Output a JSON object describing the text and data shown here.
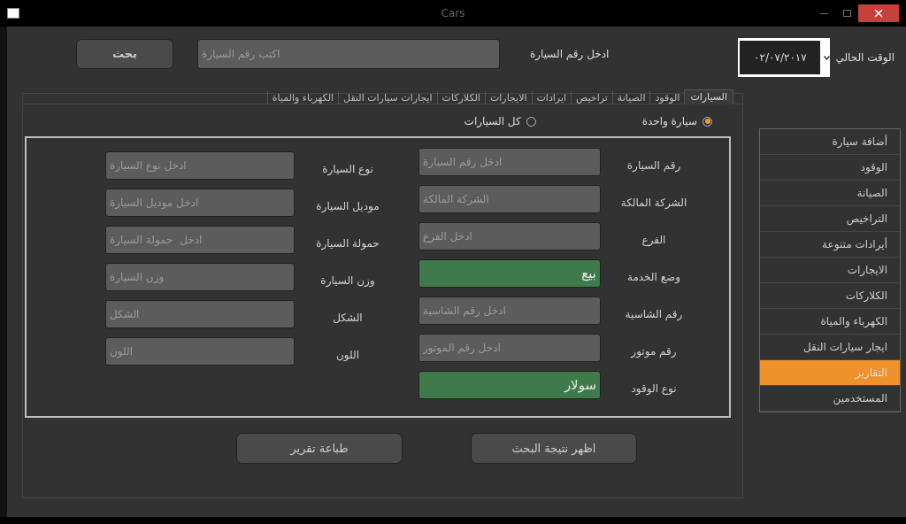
{
  "window": {
    "title": "Cars"
  },
  "search": {
    "label": "ادخل رقم السيارة",
    "placeholder": "اكتب رقم السيارة",
    "button": "بحث"
  },
  "current_time": {
    "label": "الوقت الحالي",
    "value": "٠٢/٠٧/٢٠١٧"
  },
  "tabs": [
    {
      "label": "السيارات",
      "selected": true
    },
    {
      "label": "الوقود",
      "selected": false
    },
    {
      "label": "الصيانة",
      "selected": false
    },
    {
      "label": "تراخيص",
      "selected": false
    },
    {
      "label": "ايرادات",
      "selected": false
    },
    {
      "label": "الايجارات",
      "selected": false
    },
    {
      "label": "الكلاركات",
      "selected": false
    },
    {
      "label": "ايجارات سيارات النقل",
      "selected": false
    },
    {
      "label": "الكهرباء والمياة",
      "selected": false
    }
  ],
  "scope": [
    {
      "label": "سيارة واحدة",
      "selected": true
    },
    {
      "label": "كل السيارات",
      "selected": false
    }
  ],
  "form_right": [
    {
      "label": "رقم السيارة",
      "kind": "text",
      "placeholder": "ادخل رقم السيارة"
    },
    {
      "label": "الشركة المالكة",
      "kind": "text",
      "placeholder": "الشركة المالكة"
    },
    {
      "label": "الفرع",
      "kind": "text",
      "placeholder": "ادخل الفرع"
    },
    {
      "label": "وضع الخدمة",
      "kind": "combo",
      "value": "بيع"
    },
    {
      "label": "رقم الشاسية",
      "kind": "text",
      "placeholder": "ادخل رقم الشاسية"
    },
    {
      "label": "رقم موتور",
      "kind": "text",
      "placeholder": "ادخل رقم الموتور"
    },
    {
      "label": "نوع الوقود",
      "kind": "combo",
      "value": "سولار"
    }
  ],
  "form_left": [
    {
      "label": "نوع السيارة",
      "kind": "text",
      "placeholder": "ادخل نوع السيارة"
    },
    {
      "label": "موديل السيارة",
      "kind": "text",
      "placeholder": "ادخل موديل السيارة"
    },
    {
      "label": "حمولة السيارة",
      "kind": "text",
      "placeholder": "ادخل  حمولة السيارة"
    },
    {
      "label": "وزن السيارة",
      "kind": "text",
      "placeholder": "وزن السيارة"
    },
    {
      "label": "الشكل",
      "kind": "text",
      "placeholder": "الشكل"
    },
    {
      "label": "اللون",
      "kind": "text",
      "placeholder": "اللون"
    }
  ],
  "buttons": [
    "اظهر نتيجة البحث",
    "طباعة تقرير"
  ],
  "sidebar": {
    "items": [
      {
        "label": "أضافة سيارة",
        "selected": false
      },
      {
        "label": "الوقود",
        "selected": false
      },
      {
        "label": "الصيانة",
        "selected": false
      },
      {
        "label": "التراخيص",
        "selected": false
      },
      {
        "label": "أيرادات متنوعة",
        "selected": false
      },
      {
        "label": "الايجارات",
        "selected": false
      },
      {
        "label": "الكلاركات",
        "selected": false
      },
      {
        "label": "الكهرباء والمياة",
        "selected": false
      },
      {
        "label": "ايجار سيارات النقل",
        "selected": false
      },
      {
        "label": "التقارير",
        "selected": true
      },
      {
        "label": "المستخدمين",
        "selected": false
      }
    ]
  }
}
